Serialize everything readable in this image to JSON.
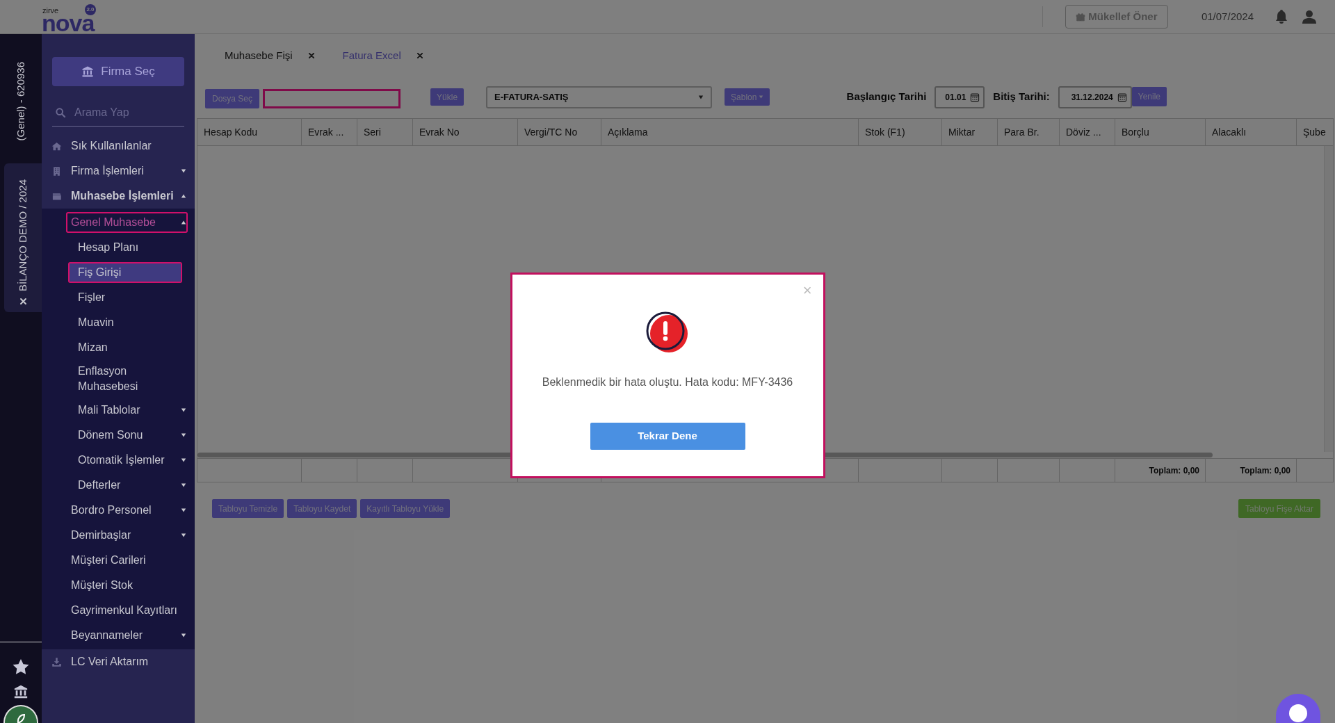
{
  "topbar": {
    "logo": {
      "small": "zirve",
      "brand": "nova",
      "version": "2.0"
    },
    "refer_button": "Mükellef Öner",
    "date": "01/07/2024"
  },
  "left_strip": {
    "company": "(Genel) - 620936",
    "workspace": "BİLANÇO DEMO / 2024"
  },
  "sidebar": {
    "company_button": "Firma Seç",
    "search": {
      "placeholder": "Arama Yap"
    },
    "items": [
      {
        "label": "Sık Kullanılanlar",
        "selected": false,
        "highlighted": false
      },
      {
        "label": "Firma İşlemleri",
        "selected": false,
        "highlighted": false,
        "expanded": false
      },
      {
        "label": "Muhasebe İşlemleri",
        "selected": false,
        "highlighted": false,
        "expanded": true,
        "children": [
          {
            "label": "Genel Muhasebe",
            "selected": false,
            "highlighted": true,
            "expanded": true,
            "children": [
              {
                "label": "Hesap Planı",
                "selected": false,
                "highlighted": false
              },
              {
                "label": "Fiş Girişi",
                "selected": true,
                "highlighted": true
              },
              {
                "label": "Fişler",
                "selected": false,
                "highlighted": false
              },
              {
                "label": "Muavin",
                "selected": false,
                "highlighted": false
              },
              {
                "label": "Mizan",
                "selected": false,
                "highlighted": false
              },
              {
                "label": "Enflasyon Muhasebesi",
                "selected": false,
                "highlighted": false
              },
              {
                "label": "Mali Tablolar",
                "selected": false,
                "highlighted": false,
                "expanded": false
              },
              {
                "label": "Dönem Sonu",
                "selected": false,
                "highlighted": false,
                "expanded": false
              },
              {
                "label": "Otomatik İşlemler",
                "selected": false,
                "highlighted": false,
                "expanded": false
              },
              {
                "label": "Defterler",
                "selected": false,
                "highlighted": false,
                "expanded": false
              }
            ]
          },
          {
            "label": "Bordro Personel",
            "selected": false,
            "highlighted": false,
            "expanded": false
          },
          {
            "label": "Demirbaşlar",
            "selected": false,
            "highlighted": false,
            "expanded": false
          },
          {
            "label": "Müşteri Carileri",
            "selected": false,
            "highlighted": false
          },
          {
            "label": "Müşteri Stok",
            "selected": false,
            "highlighted": false
          },
          {
            "label": "Gayrimenkul Kayıtları",
            "selected": false,
            "highlighted": false
          },
          {
            "label": "Beyannameler",
            "selected": false,
            "highlighted": false,
            "expanded": false
          }
        ]
      },
      {
        "label": "LC Veri Aktarım",
        "selected": false,
        "highlighted": false
      }
    ]
  },
  "tabs": [
    {
      "label": "Muhasebe Fişi",
      "selected": false
    },
    {
      "label": "Fatura Excel",
      "selected": true
    }
  ],
  "toolbar": {
    "file_button": "Dosya Seç",
    "file_field": {
      "highlighted": true
    },
    "upload_button": "Yükle",
    "type_select": "E-FATURA-SATIŞ",
    "template_button": "Şablon",
    "start_label": "Başlangıç Tarihi",
    "start_date": "01.01",
    "end_label": "Bitiş Tarihi:",
    "end_date": "31.12.2024",
    "refresh_button": "Yenile"
  },
  "table": {
    "columns": [
      "Hesap Kodu",
      "Evrak ...",
      "Seri",
      "Evrak No",
      "Vergi/TC No",
      "Açıklama",
      "Stok (F1)",
      "Miktar",
      "Para Br.",
      "Döviz ...",
      "Borçlu",
      "Alacaklı",
      "Şube"
    ],
    "totals": {
      "borclu": "Toplam: 0,00",
      "alacakli": "Toplam: 0,00"
    }
  },
  "table_buttons": [
    "Tabloyu Temizle",
    "Tabloyu Kaydet",
    "Kayıtlı Tabloyu Yükle"
  ],
  "transfer_button": "Tabloyu Fişe Aktar",
  "dialog": {
    "message": "Beklenmedik bir hata oluştu. Hata kodu: MFY-3436",
    "button": "Tekrar Dene",
    "close": "×"
  }
}
